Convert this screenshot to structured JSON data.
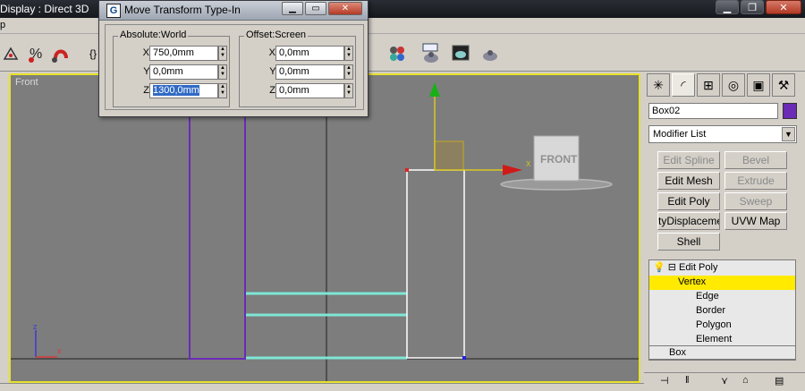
{
  "app": {
    "title": "Display : Direct 3D",
    "menu_label": "p",
    "window_buttons": [
      "▁",
      "❐",
      "✕"
    ]
  },
  "toolbar": {
    "icons": [
      "snap-icon",
      "percent-snap-icon",
      "magnet-icon",
      "named-selection-icon",
      "material-editor-icon",
      "render-setup-icon",
      "render-frame-icon",
      "render-production-icon"
    ]
  },
  "viewport": {
    "label": "Front",
    "axis_x": "x",
    "axis_z": "z",
    "cube_label": "FRONT",
    "gizmo_axis_label": "X"
  },
  "dialog": {
    "title": "Move Transform Type-In",
    "icon_letter": "G",
    "buttons": [
      "▁",
      "▭",
      "✕"
    ],
    "absolute": {
      "legend": "Absolute:World",
      "x_label": "X:",
      "x_value": "750,0mm",
      "y_label": "Y:",
      "y_value": "0,0mm",
      "z_label": "Z:",
      "z_value": "1300,0mm"
    },
    "offset": {
      "legend": "Offset:Screen",
      "x_label": "X:",
      "x_value": "0,0mm",
      "y_label": "Y:",
      "y_value": "0,0mm",
      "z_label": "Z:",
      "z_value": "0,0mm"
    }
  },
  "command_panel": {
    "object_name": "Box02",
    "object_color": "#6a2bb5",
    "modifier_list": "Modifier List",
    "buttons": [
      {
        "label": "Edit Spline",
        "enabled": false
      },
      {
        "label": "Bevel",
        "enabled": false
      },
      {
        "label": "Edit Mesh",
        "enabled": true
      },
      {
        "label": "Extrude",
        "enabled": false
      },
      {
        "label": "Edit Poly",
        "enabled": true
      },
      {
        "label": "Sweep",
        "enabled": false
      },
      {
        "label": "tyDisplacement",
        "enabled": true
      },
      {
        "label": "UVW Map",
        "enabled": true
      },
      {
        "label": "Shell",
        "enabled": true
      }
    ],
    "stack": {
      "modifier": "Edit Poly",
      "subobjects": [
        "Vertex",
        "Edge",
        "Border",
        "Polygon",
        "Element"
      ],
      "selected": "Vertex",
      "base": "Box"
    }
  },
  "colors": {
    "viewport_border": "#e8e22a",
    "selection_highlight": "#ffea00",
    "object_outline": "#6a2bb5"
  }
}
